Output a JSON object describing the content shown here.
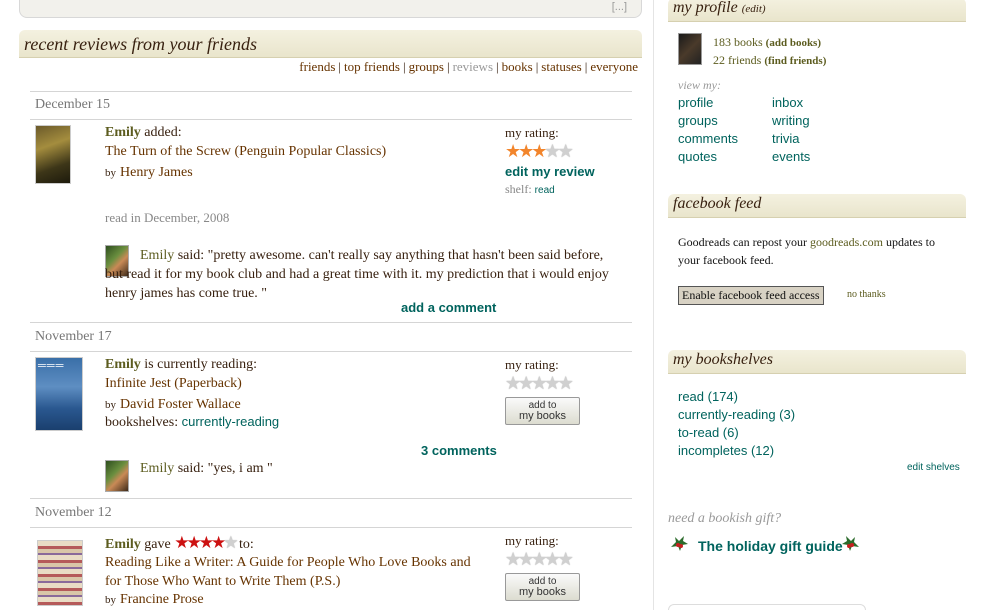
{
  "top_tail": "[...]",
  "main_header": "recent reviews from your friends",
  "filters": [
    "friends",
    "top friends",
    "groups",
    "reviews",
    "books",
    "statuses",
    "everyone"
  ],
  "entries": [
    {
      "date": "December 15",
      "actor": "Emily",
      "action": " added:",
      "title": "The Turn of the Screw (Penguin Popular Classics)",
      "by": "by",
      "author": "Henry James",
      "rating_label": "my rating:",
      "my_rating": 3,
      "edit_label": "edit my review",
      "shelf_label": "shelf:",
      "shelf": "read",
      "read_in": "read in December, 2008",
      "comment_user": "Emily",
      "comment_text": " said: \"pretty awesome. can't really say anything that hasn't been said before, but read it for my book club and had a great time with it. my prediction that i would enjoy henry james has come true. \"",
      "comment_link": "add a comment"
    },
    {
      "date": "November 17",
      "actor": "Emily",
      "action": " is currently reading:",
      "title": "Infinite Jest (Paperback)",
      "by": "by",
      "author": "David Foster Wallace",
      "bookshelves_label": "bookshelves:",
      "bookshelf": "currently-reading",
      "rating_label": "my rating:",
      "my_rating": 0,
      "add_btn_top": "add to",
      "add_btn_bottom": "my books",
      "comments_link": "3 comments",
      "comment_user": "Emily",
      "comment_text": " said: \"yes, i am \""
    },
    {
      "date": "November 12",
      "actor": "Emily",
      "action_pre": " gave ",
      "given_rating": 4,
      "action_post": " to:",
      "title": "Reading Like a Writer: A Guide for People Who Love Books and for Those Who Want to Write Them (P.S.)",
      "by": "by",
      "author": "Francine Prose",
      "rating_label": "my rating:",
      "my_rating": 0,
      "add_btn_top": "add to",
      "add_btn_bottom": "my books"
    }
  ],
  "profile": {
    "header": "my profile",
    "edit": "(edit)",
    "books_count": "183 books",
    "add_books": "(add books)",
    "friends_count": "22 friends",
    "find_friends": "(find friends)",
    "view_my": "view my:",
    "links_left": [
      "profile",
      "groups",
      "comments",
      "quotes"
    ],
    "links_right": [
      "inbox",
      "writing",
      "trivia",
      "events"
    ]
  },
  "facebook": {
    "header": "facebook feed",
    "text_pre": "Goodreads can repost your ",
    "site": "goodreads.com",
    "text_post": " updates to your facebook feed.",
    "button": "Enable facebook feed access",
    "no_thanks": "no thanks"
  },
  "bookshelves": {
    "header": "my bookshelves",
    "items": [
      "read (174)",
      "currently-reading (3)",
      "to-read (6)",
      "incompletes (12)"
    ],
    "edit": "edit shelves"
  },
  "gift": {
    "question": "need a bookish gift?",
    "link": "The holiday gift guide"
  },
  "colors": {
    "header_bg": "#ece8d2",
    "link_brown": "#663300",
    "link_green": "#00635d",
    "star_orange": "#f2852c",
    "star_red": "#cc1111"
  }
}
